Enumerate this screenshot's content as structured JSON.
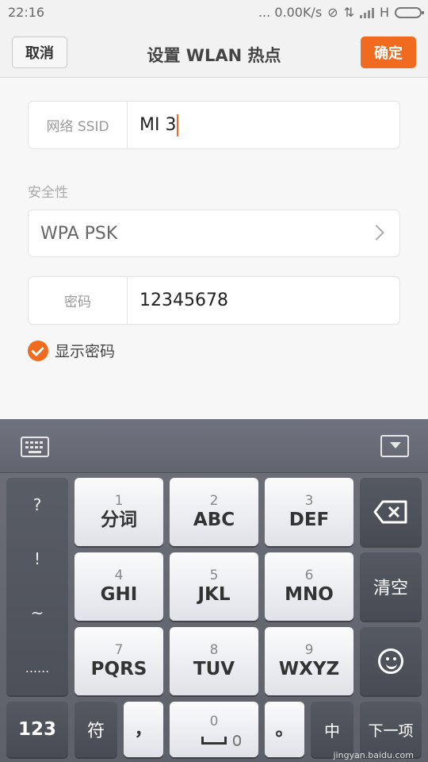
{
  "status_bar": {
    "time": "22:16",
    "speed": "... 0.00K/s",
    "network": "H"
  },
  "title_bar": {
    "cancel": "取消",
    "title": "设置 WLAN 热点",
    "confirm": "确定"
  },
  "form": {
    "ssid_label": "网络 SSID",
    "ssid_value": "MI 3",
    "security_section": "安全性",
    "security_value": "WPA PSK",
    "password_label": "密码",
    "password_value": "12345678",
    "show_password": "显示密码",
    "show_password_checked": true
  },
  "keyboard": {
    "left_column": [
      "?",
      "!",
      "~",
      "......"
    ],
    "keys": [
      {
        "num": "1",
        "label": "分词"
      },
      {
        "num": "2",
        "label": "ABC"
      },
      {
        "num": "3",
        "label": "DEF"
      },
      {
        "num": "4",
        "label": "GHI"
      },
      {
        "num": "5",
        "label": "JKL"
      },
      {
        "num": "6",
        "label": "MNO"
      },
      {
        "num": "7",
        "label": "PQRS"
      },
      {
        "num": "8",
        "label": "TUV"
      },
      {
        "num": "9",
        "label": "WXYZ"
      }
    ],
    "clear": "清空",
    "bottom": {
      "k123": "123",
      "symbol": "符",
      "comma": "，",
      "zero": "0",
      "period": "。",
      "lang": "中",
      "next": "下一项"
    },
    "icons": [
      "keyboard-icon",
      "hide-keyboard-icon",
      "backspace-icon",
      "emoji-icon",
      "mic-icon"
    ]
  },
  "watermark": "jingyan.baidu.com",
  "colors": {
    "accent": "#f06b1f"
  }
}
